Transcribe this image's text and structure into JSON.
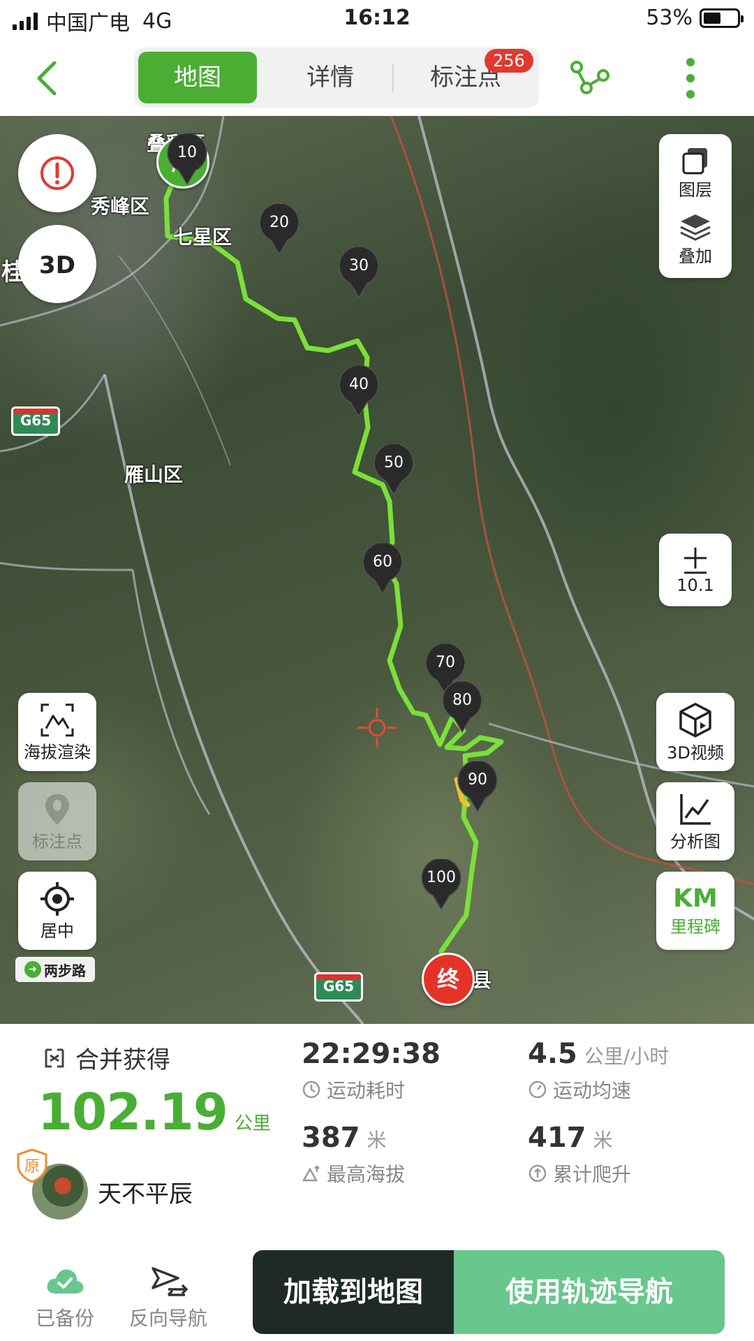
{
  "status_bar": {
    "carrier": "中国广电",
    "network": "4G",
    "time": "16:12",
    "battery": "53%",
    "battery_level": 0.53
  },
  "header": {
    "tabs": [
      {
        "label": "地图",
        "active": true
      },
      {
        "label": "详情",
        "active": false
      },
      {
        "label": "标注点",
        "active": false
      }
    ],
    "waypoint_count": "256"
  },
  "map": {
    "place_labels": [
      "叠彩区",
      "秀峰区",
      "七星区",
      "桂林",
      "雁山区",
      "阳朔县"
    ],
    "highway_labels": [
      "G65",
      "G65"
    ],
    "start_label": "起",
    "end_label": "终",
    "km_markers": [
      "10",
      "20",
      "30",
      "40",
      "50",
      "60",
      "70",
      "80",
      "90",
      "100"
    ],
    "left_controls": {
      "elevation": "海拔渲染",
      "waypoints": "标注点",
      "center": "居中"
    },
    "right_controls": {
      "layers": "图层",
      "overlay": "叠加",
      "zoom_level": "10.1",
      "video_3d": "3D视频",
      "analysis": "分析图",
      "km_short": "KM",
      "milestone": "里程碑"
    },
    "watermark": "两步路",
    "route_color": "#7be03a",
    "end_color": "#e53227",
    "start_color": "#4aae35"
  },
  "stats": {
    "merged_label": "合并获得",
    "distance_value": "102.19",
    "distance_unit": "公里",
    "user_badge": "原",
    "username": "天不平辰",
    "duration": {
      "value": "22:29:38",
      "label": "运动耗时"
    },
    "avg_speed": {
      "value": "4.5",
      "unit": "公里/小时",
      "label": "运动均速"
    },
    "max_altitude": {
      "value": "387",
      "unit": "米",
      "label": "最高海拔"
    },
    "total_climb": {
      "value": "417",
      "unit": "米",
      "label": "累计爬升"
    }
  },
  "bottom_bar": {
    "backed_up": "已备份",
    "reverse_nav": "反向导航",
    "load_to_map": "加载到地图",
    "use_track_nav": "使用轨迹导航"
  },
  "colors": {
    "accent": "#4aae35",
    "dark_button": "#1f2a25",
    "nav_button": "#67c78c",
    "badge": "#e03a2f"
  }
}
